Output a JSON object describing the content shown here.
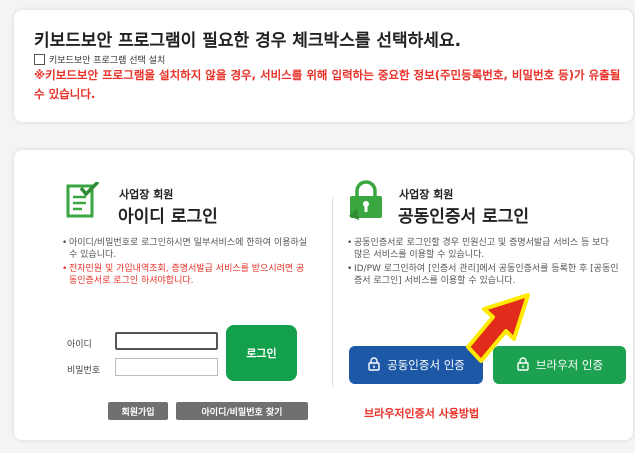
{
  "keyboard_security": {
    "title": "키보드보안 프로그램이 필요한 경우 체크박스를 선택하세요.",
    "checkbox_label": "키보드보안 프로그램 선택 설치",
    "warning": "※키보드보안 프로그램을 설치하지 않을 경우, 서비스를 위해 입력하는 중요한 정보(주민등록번호, 비밀번호 등)가 유출될 수 있습니다."
  },
  "id_login": {
    "sub_label": "사업장 회원",
    "main_label": "아이디 로그인",
    "bullets": [
      "아이디/비밀번호로 로그인하시면 일부서비스에 한하여 이용하실 수 있습니다.",
      "전자민원 및 가입내역조회, 증명서발급 서비스를 받으시려면 공동인증서로 로그인 하셔야합니다."
    ],
    "id_label": "아이디",
    "password_label": "비밀번호",
    "login_button": "로그인",
    "signup_button": "회원가입",
    "find_button": "아이디/비밀번호 찾기",
    "icon": "document-check-icon"
  },
  "cert_login": {
    "sub_label": "사업장 회원",
    "main_label": "공동인증서 로그인",
    "bullets": [
      "공동인증서로 로그인할 경우 민원신고 및 증명서발급 서비스 등 보다 많은 서비스를 이용할 수 있습니다.",
      "ID/PW 로그인하여 [인증서 관리]에서 공동인증서를 등록한 후 [공동인증서 로그인] 서비스를 이용할 수 있습니다."
    ],
    "cert_button": "공동인증서 인증",
    "browser_button": "브라우저 인증",
    "browser_link": "브라우저인증서 사용방법",
    "icon": "certificate-lock-icon"
  },
  "colors": {
    "warning_red": "#e8322a",
    "login_green": "#12a04a",
    "cert_blue": "#1d58a6",
    "browser_green": "#1ba14f"
  }
}
